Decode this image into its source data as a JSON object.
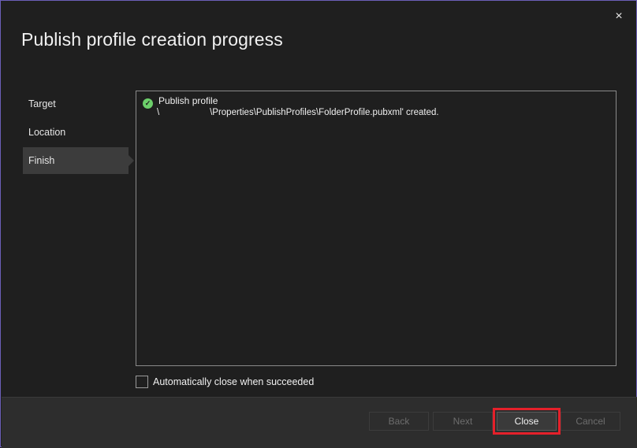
{
  "dialog": {
    "title": "Publish profile creation progress",
    "close_icon": "×"
  },
  "steps": [
    {
      "label": "Target"
    },
    {
      "label": "Location"
    },
    {
      "label": "Finish"
    }
  ],
  "output": {
    "line1": "Publish profile",
    "line2": "\\                    \\Properties\\PublishProfiles\\FolderProfile.pubxml' created.",
    "status_icon": "check-circle-icon",
    "status_color": "#6ccf6a"
  },
  "options": {
    "auto_close_label": "Automatically close when succeeded",
    "auto_close_checked": false
  },
  "buttons": {
    "back": "Back",
    "next": "Next",
    "close": "Close",
    "cancel": "Cancel"
  },
  "colors": {
    "accent_border": "#6b5fb8",
    "highlight": "#e5202a"
  }
}
